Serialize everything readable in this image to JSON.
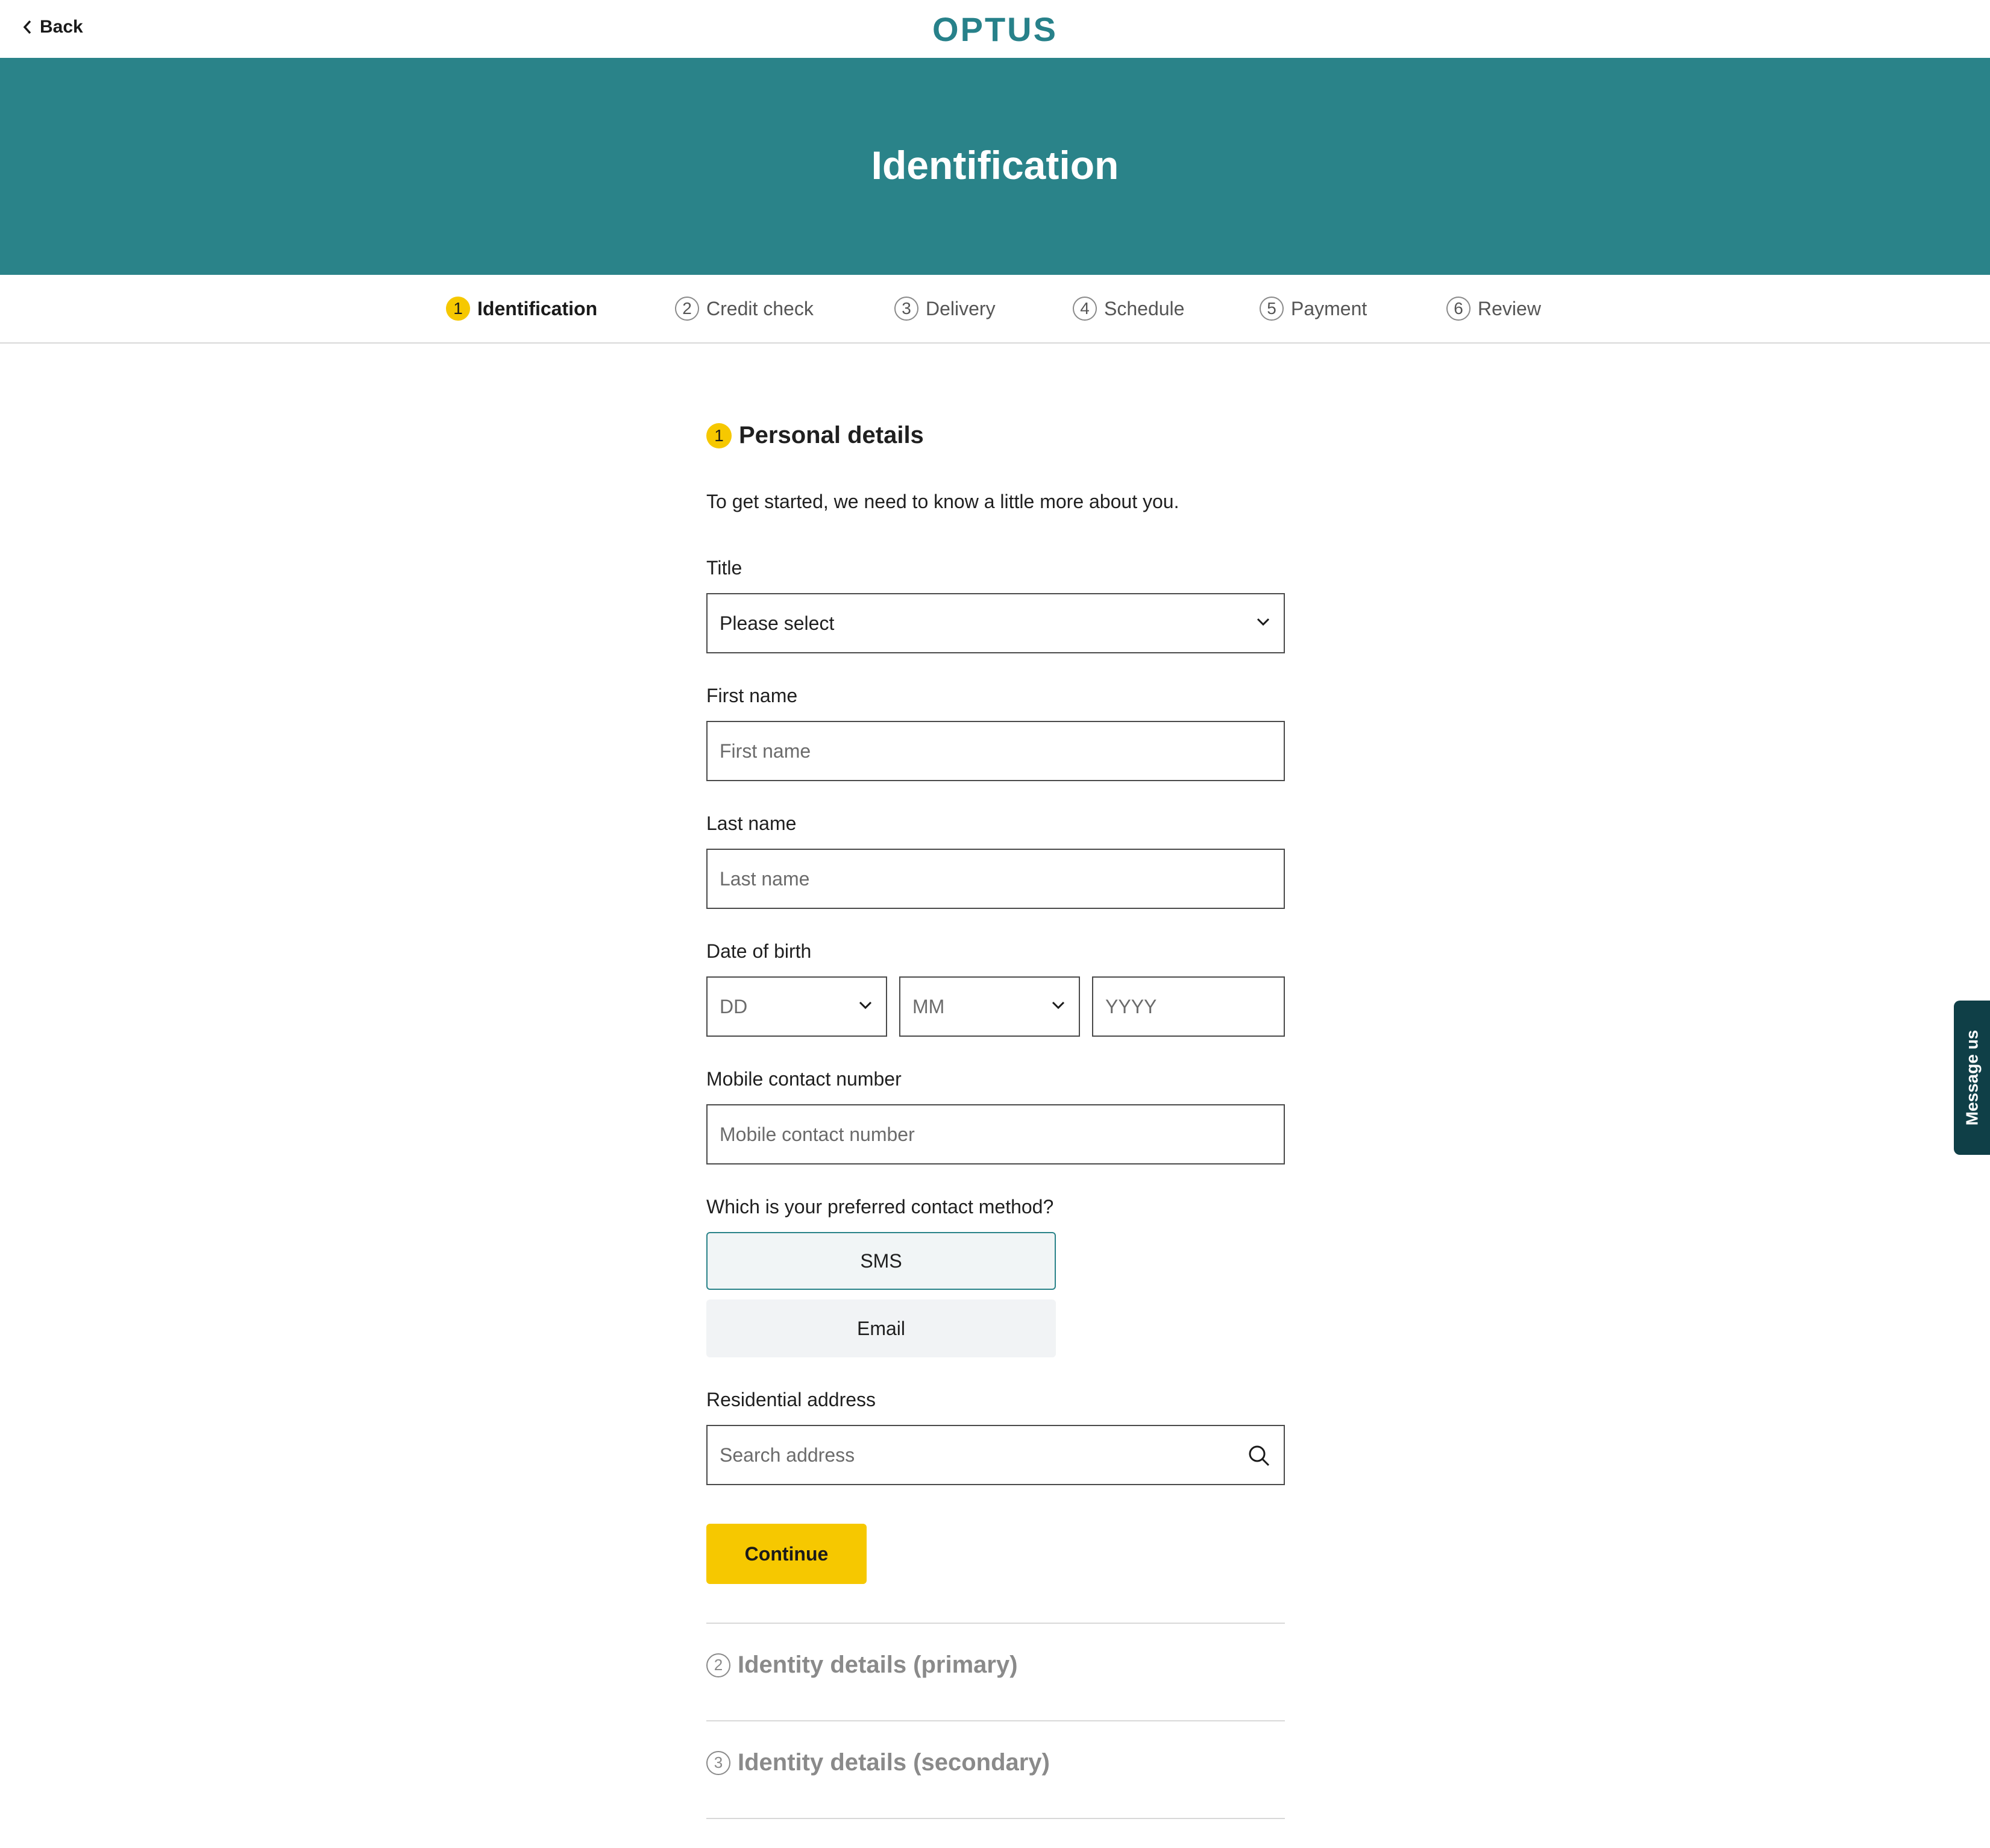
{
  "header": {
    "back_label": "Back",
    "logo": "OPTUS"
  },
  "hero": {
    "title": "Identification"
  },
  "stepper": {
    "steps": [
      {
        "num": "1",
        "label": "Identification",
        "active": true
      },
      {
        "num": "2",
        "label": "Credit check"
      },
      {
        "num": "3",
        "label": "Delivery"
      },
      {
        "num": "4",
        "label": "Schedule"
      },
      {
        "num": "5",
        "label": "Payment"
      },
      {
        "num": "6",
        "label": "Review"
      }
    ]
  },
  "personal": {
    "num": "1",
    "title": "Personal details",
    "intro": "To get started, we need to know a little more about you.",
    "title_label": "Title",
    "title_value": "Please select",
    "first_name_label": "First name",
    "first_name_placeholder": "First name",
    "last_name_label": "Last name",
    "last_name_placeholder": "Last name",
    "dob_label": "Date of birth",
    "dob_day": "DD",
    "dob_month": "MM",
    "dob_year": "YYYY",
    "mobile_label": "Mobile contact number",
    "mobile_placeholder": "Mobile contact number",
    "contact_method_label": "Which is your preferred contact method?",
    "contact_options": [
      "SMS",
      "Email"
    ],
    "contact_selected": "SMS",
    "address_label": "Residential address",
    "address_placeholder": "Search address",
    "continue_label": "Continue"
  },
  "sections": [
    {
      "num": "2",
      "title": "Identity details (primary)"
    },
    {
      "num": "3",
      "title": "Identity details (secondary)"
    }
  ],
  "message_tab": "Message us",
  "colors": {
    "brand_teal": "#2a8389",
    "accent_yellow": "#f6c800",
    "message_tab": "#0f3f47"
  }
}
